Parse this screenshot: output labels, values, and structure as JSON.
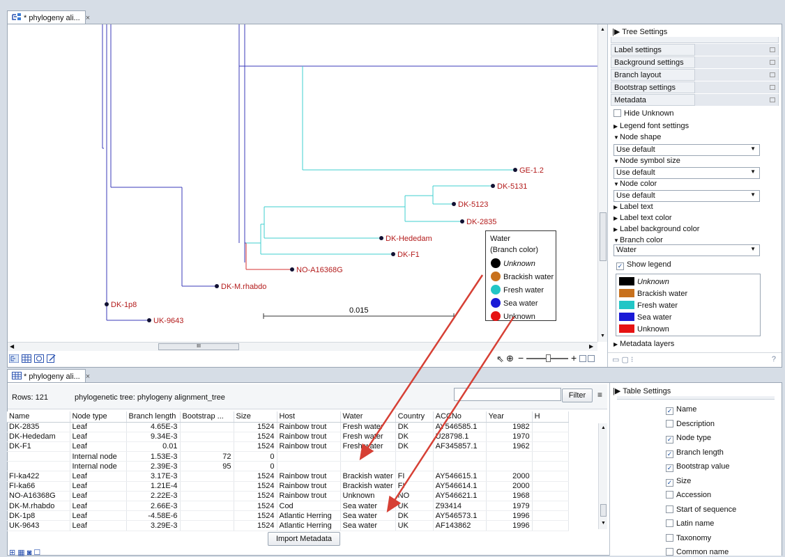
{
  "top_tab": {
    "title": "* phylogeny ali...",
    "close": "×"
  },
  "bottom_tab": {
    "title": "* phylogeny ali...",
    "close": "×"
  },
  "tree": {
    "leaves": [
      {
        "label": "GE-1.2"
      },
      {
        "label": "DK-5131"
      },
      {
        "label": "DK-5123"
      },
      {
        "label": "DK-2835"
      },
      {
        "label": "DK-Hededam"
      },
      {
        "label": "DK-F1"
      },
      {
        "label": "NO-A16368G"
      },
      {
        "label": "DK-M.rhabdo"
      },
      {
        "label": "DK-1p8"
      },
      {
        "label": "UK-9643"
      }
    ],
    "scale_label": "0.015",
    "hscroll_grip": "III",
    "legend": {
      "title": "Water",
      "subtitle": "(Branch color)",
      "items": [
        {
          "label": "Unknown",
          "color": "#000000",
          "italic": true
        },
        {
          "label": "Brackish water",
          "color": "#c8711d"
        },
        {
          "label": "Fresh water",
          "color": "#22c6c6"
        },
        {
          "label": "Sea water",
          "color": "#1a1ad6"
        },
        {
          "label": "Unknown",
          "color": "#e61313"
        }
      ]
    },
    "colors": {
      "fresh": "#3fcfcf",
      "sea": "#3a3ab8",
      "unknown_red": "#d63030",
      "label_red": "#b31b1b"
    }
  },
  "tree_settings": {
    "title": "Tree Settings",
    "headers": [
      "Label settings",
      "Background settings",
      "Branch layout",
      "Bootstrap settings",
      "Metadata"
    ],
    "hide_unknown": "Hide Unknown",
    "legend_font": "Legend font settings",
    "node_shape": "Node shape",
    "node_shape_value": "Use default",
    "node_symbol_size": "Node symbol size",
    "node_symbol_size_value": "Use default",
    "node_color": "Node color",
    "node_color_value": "Use default",
    "label_text": "Label text",
    "label_text_color": "Label text color",
    "label_background_color": "Label background color",
    "branch_color": "Branch color",
    "branch_color_value": "Water",
    "show_legend": "Show legend",
    "legend_items": [
      {
        "label": "Unknown",
        "color": "#000000",
        "italic": true
      },
      {
        "label": "Brackish water",
        "color": "#c8711d"
      },
      {
        "label": "Fresh water",
        "color": "#22c6c6"
      },
      {
        "label": "Sea water",
        "color": "#1a1ad6"
      },
      {
        "label": "Unknown",
        "color": "#e61313"
      }
    ],
    "metadata_layers": "Metadata layers"
  },
  "table_toolbar": {
    "rows": "Rows: 121",
    "description": "phylogenetic tree: phylogeny alignment_tree",
    "filter": "Filter",
    "import": "Import Metadata"
  },
  "table": {
    "columns": [
      "Name",
      "Node type",
      "Branch length",
      "Bootstrap ...",
      "Size",
      "Host",
      "Water",
      "Country",
      "ACCNo",
      "Year",
      "H"
    ],
    "rows": [
      [
        "DK-2835",
        "Leaf",
        "4.65E-3",
        "",
        "1524",
        "Rainbow trout",
        "Fresh water",
        "DK",
        "AY546585.1",
        "1982",
        ""
      ],
      [
        "DK-Hededam",
        "Leaf",
        "9.34E-3",
        "",
        "1524",
        "Rainbow trout",
        "Fresh water",
        "DK",
        "U28798.1",
        "1970",
        ""
      ],
      [
        "DK-F1",
        "Leaf",
        "0.01",
        "",
        "1524",
        "Rainbow trout",
        "Fresh water",
        "DK",
        "AF345857.1",
        "1962",
        ""
      ],
      [
        "",
        "Internal node",
        "1.53E-3",
        "72",
        "0",
        "",
        "",
        "",
        "",
        "",
        ""
      ],
      [
        "",
        "Internal node",
        "2.39E-3",
        "95",
        "0",
        "",
        "",
        "",
        "",
        "",
        ""
      ],
      [
        "FI-ka422",
        "Leaf",
        "3.17E-3",
        "",
        "1524",
        "Rainbow trout",
        "Brackish water",
        "FI",
        "AY546615.1",
        "2000",
        ""
      ],
      [
        "FI-ka66",
        "Leaf",
        "1.21E-4",
        "",
        "1524",
        "Rainbow trout",
        "Brackish water",
        "FI",
        "AY546614.1",
        "2000",
        ""
      ],
      [
        "NO-A16368G",
        "Leaf",
        "2.22E-3",
        "",
        "1524",
        "Rainbow trout",
        "Unknown",
        "NO",
        "AY546621.1",
        "1968",
        ""
      ],
      [
        "DK-M.rhabdo",
        "Leaf",
        "2.66E-3",
        "",
        "1524",
        "Cod",
        "Sea water",
        "UK",
        "Z93414",
        "1979",
        ""
      ],
      [
        "DK-1p8",
        "Leaf",
        "-4.58E-6",
        "",
        "1524",
        "Atlantic Herring",
        "Sea water",
        "DK",
        "AY546573.1",
        "1996",
        ""
      ],
      [
        "UK-9643",
        "Leaf",
        "3.29E-3",
        "",
        "1524",
        "Atlantic Herring",
        "Sea water",
        "UK",
        "AF143862",
        "1996",
        ""
      ]
    ]
  },
  "table_settings": {
    "title": "Table Settings",
    "items": [
      {
        "label": "Name",
        "checked": true
      },
      {
        "label": "Description",
        "checked": false
      },
      {
        "label": "Node type",
        "checked": true
      },
      {
        "label": "Branch length",
        "checked": true
      },
      {
        "label": "Bootstrap value",
        "checked": true
      },
      {
        "label": "Size",
        "checked": true
      },
      {
        "label": "Accession",
        "checked": false
      },
      {
        "label": "Start of sequence",
        "checked": false
      },
      {
        "label": "Latin name",
        "checked": false
      },
      {
        "label": "Taxonomy",
        "checked": false
      },
      {
        "label": "Common name",
        "checked": false
      }
    ]
  }
}
